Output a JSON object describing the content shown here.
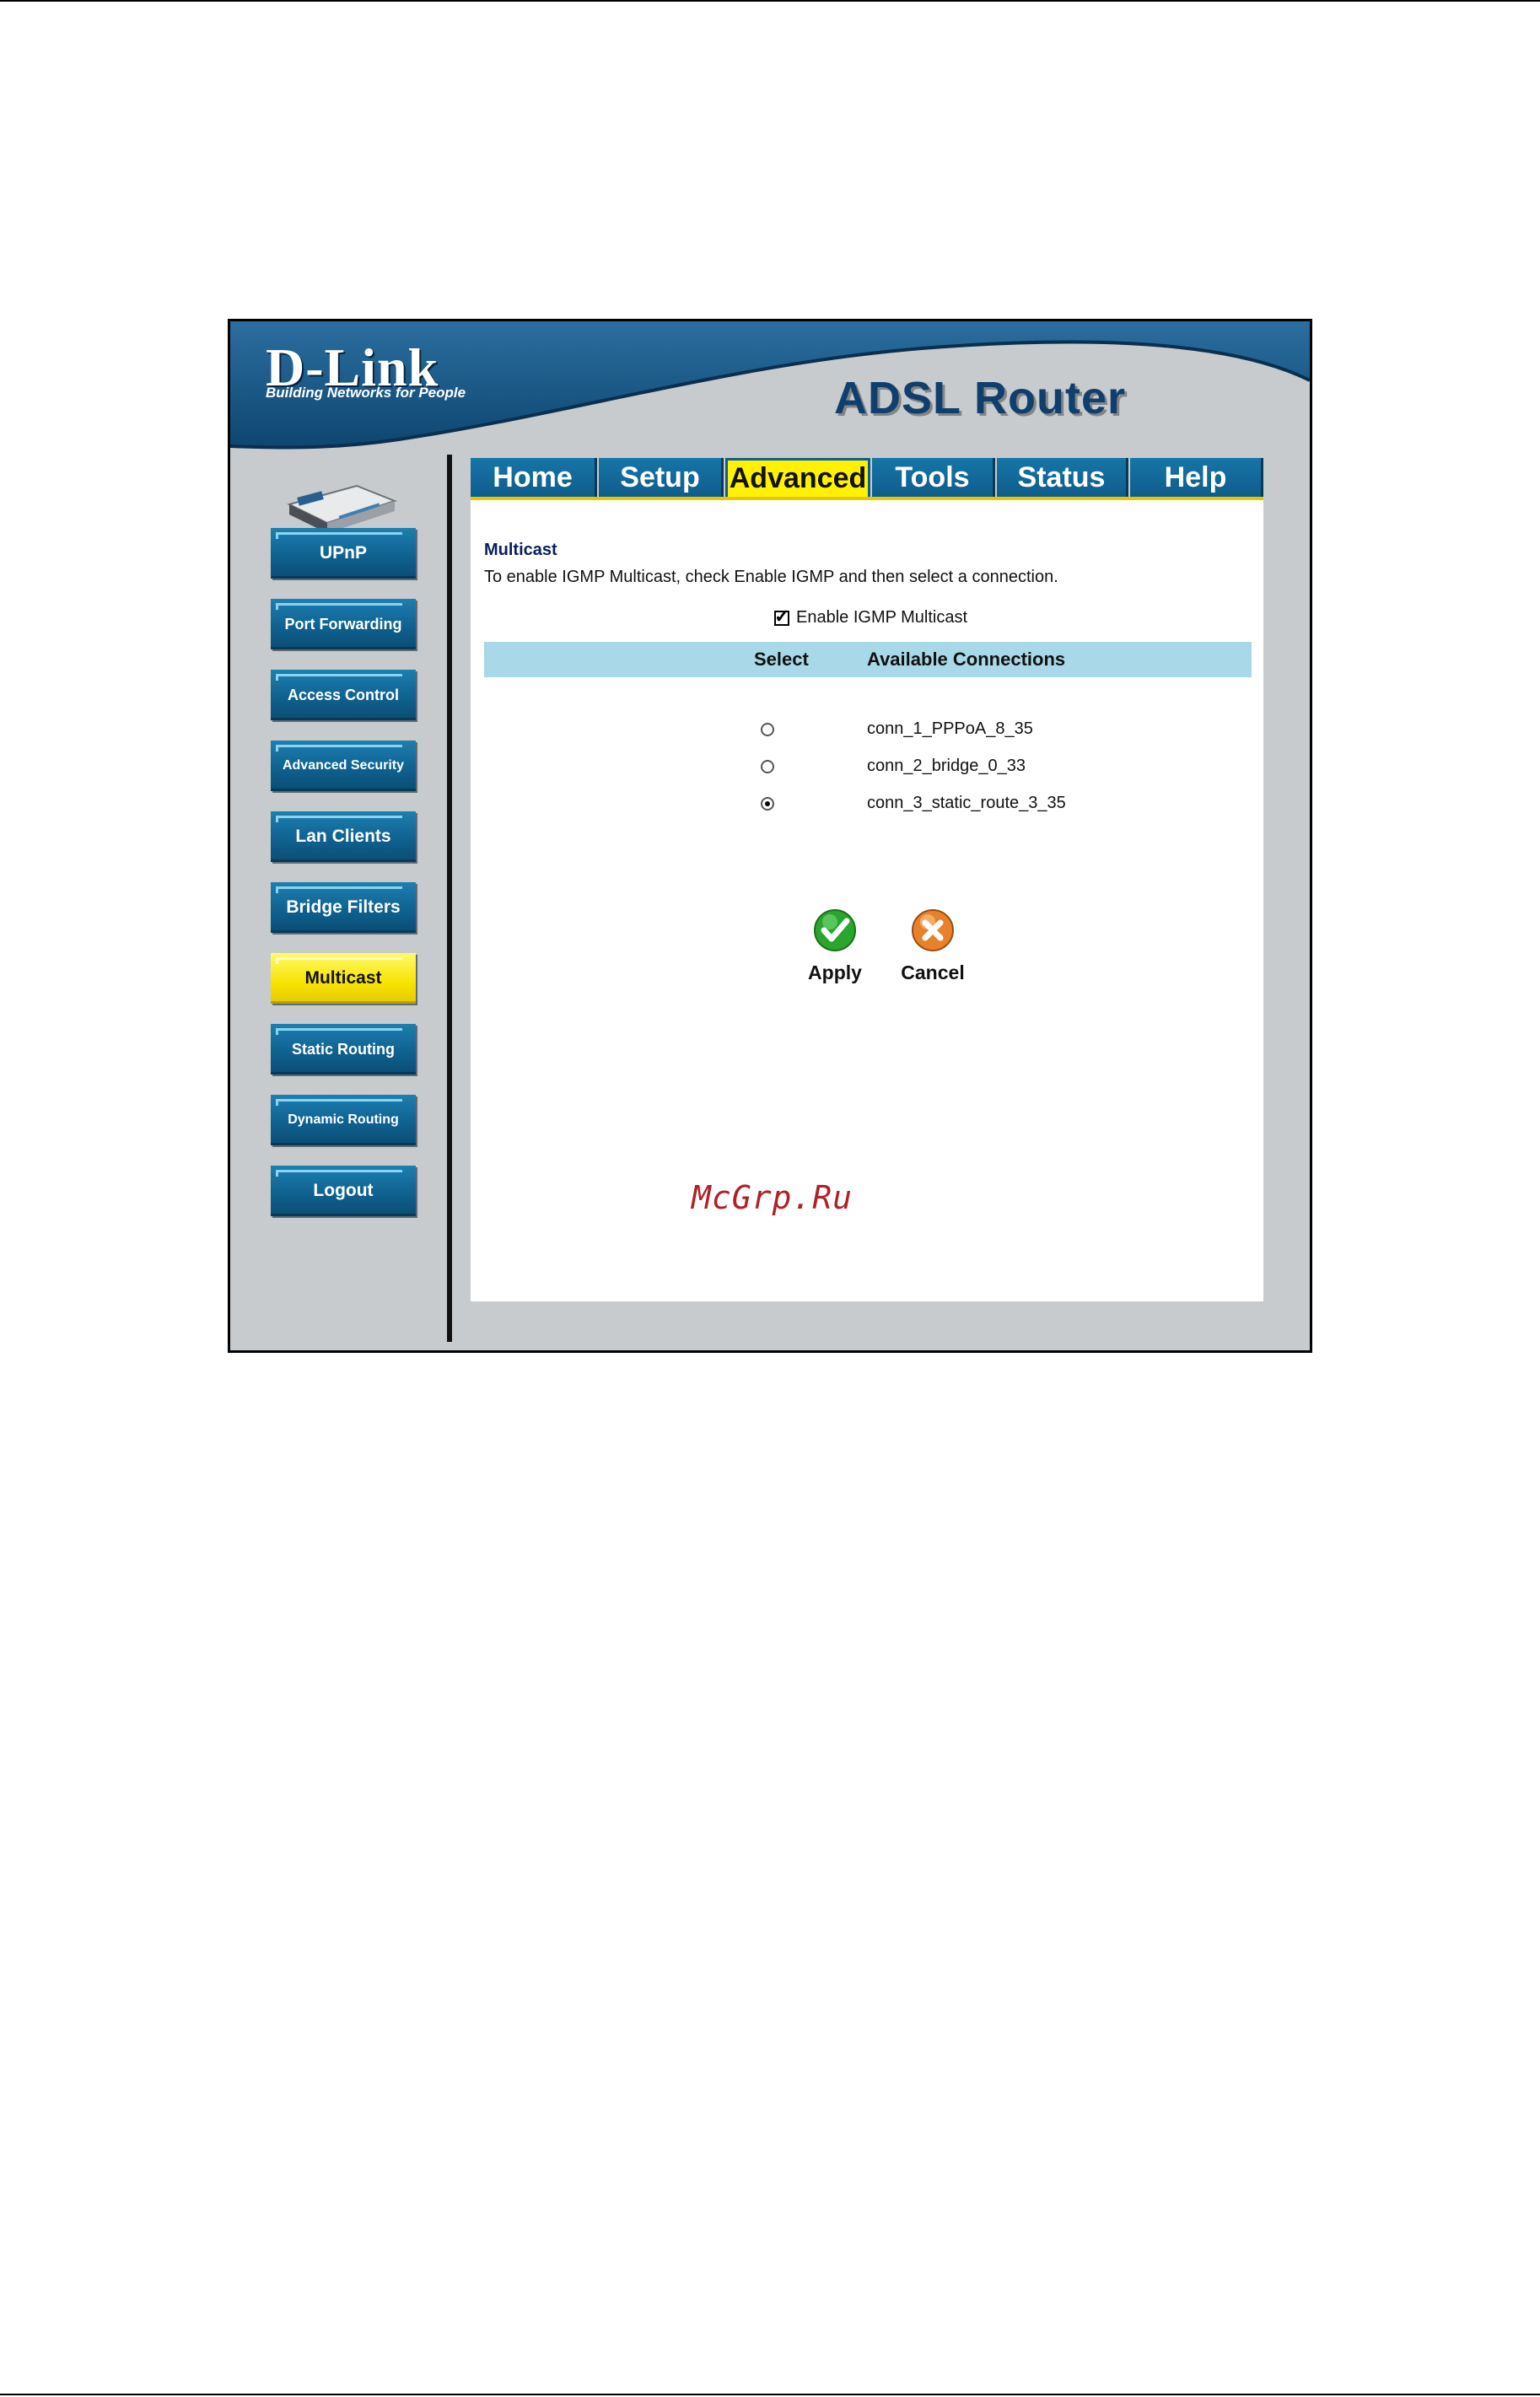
{
  "brand": {
    "logo": "D-Link",
    "tagline": "Building Networks for People",
    "product_title": "ADSL Router"
  },
  "tabs": [
    {
      "label": "Home",
      "active": false
    },
    {
      "label": "Setup",
      "active": false
    },
    {
      "label": "Advanced",
      "active": true
    },
    {
      "label": "Tools",
      "active": false
    },
    {
      "label": "Status",
      "active": false
    },
    {
      "label": "Help",
      "active": false
    }
  ],
  "sidebar": {
    "items": [
      {
        "label": "UPnP",
        "active": false
      },
      {
        "label": "Port Forwarding",
        "active": false
      },
      {
        "label": "Access Control",
        "active": false
      },
      {
        "label": "Advanced Security",
        "active": false
      },
      {
        "label": "Lan Clients",
        "active": false
      },
      {
        "label": "Bridge Filters",
        "active": false
      },
      {
        "label": "Multicast",
        "active": true
      },
      {
        "label": "Static Routing",
        "active": false
      },
      {
        "label": "Dynamic Routing",
        "active": false
      },
      {
        "label": "Logout",
        "active": false
      }
    ]
  },
  "main": {
    "section_title": "Multicast",
    "description": "To enable IGMP Multicast, check Enable IGMP and then select a connection.",
    "enable_igmp": {
      "label": "Enable IGMP Multicast",
      "checked": true
    },
    "table": {
      "headers": [
        "Select",
        "Available Connections"
      ],
      "rows": [
        {
          "name": "conn_1_PPPoA_8_35",
          "selected": false
        },
        {
          "name": "conn_2_bridge_0_33",
          "selected": false
        },
        {
          "name": "conn_3_static_route_3_35",
          "selected": true
        }
      ]
    },
    "actions": {
      "apply_label": "Apply",
      "cancel_label": "Cancel"
    }
  },
  "watermark": "McGrp.Ru",
  "colors": {
    "brand_blue": "#0e5d8b",
    "active_yellow": "#fff200",
    "header_row": "#a9d9e8",
    "panel_gray": "#c8cbcd",
    "apply_green": "#2aa52e",
    "cancel_orange": "#e8822a"
  }
}
